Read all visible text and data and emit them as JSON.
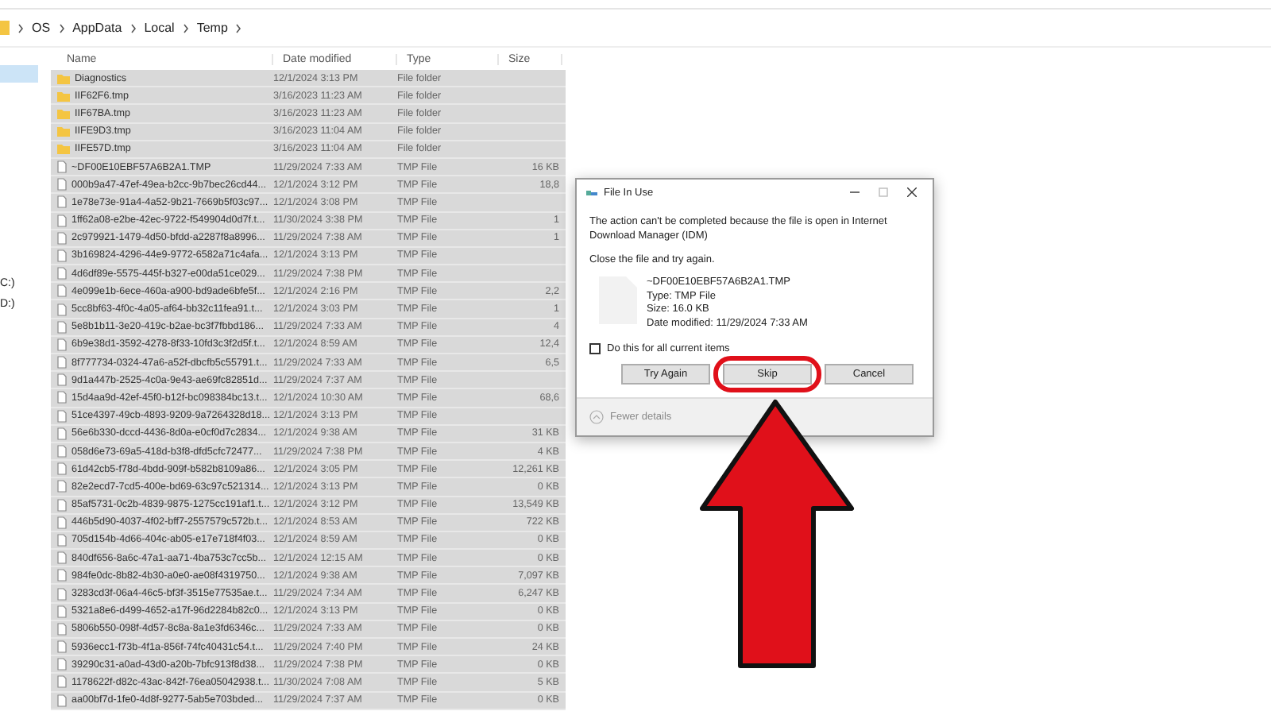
{
  "address_bar": {
    "crumbs": [
      "OS",
      "AppData",
      "Local",
      "Temp"
    ]
  },
  "nav_pane": {
    "items": [
      {
        "selected": true
      },
      {
        "label": "C:)",
        "selected": false
      },
      {
        "label": "D:)",
        "selected": false
      }
    ]
  },
  "table": {
    "columns": [
      "Name",
      "Date modified",
      "Type",
      "Size"
    ],
    "rows": [
      {
        "kind": "folder",
        "name": "Diagnostics",
        "date": "12/1/2024 3:13 PM",
        "type": "File folder"
      },
      {
        "kind": "folder",
        "name": "IIF62F6.tmp",
        "date": "3/16/2023 11:23 AM",
        "type": "File folder"
      },
      {
        "kind": "folder",
        "name": "IIF67BA.tmp",
        "date": "3/16/2023 11:23 AM",
        "type": "File folder"
      },
      {
        "kind": "folder",
        "name": "IIFE9D3.tmp",
        "date": "3/16/2023 11:04 AM",
        "type": "File folder"
      },
      {
        "kind": "folder",
        "name": "IIFE57D.tmp",
        "date": "3/16/2023 11:04 AM",
        "type": "File folder"
      },
      {
        "kind": "file",
        "name": "~DF00E10EBF57A6B2A1.TMP",
        "date": "11/29/2024 7:33 AM",
        "type": "TMP File",
        "size": "16 KB"
      },
      {
        "kind": "file",
        "name": "000b9a47-47ef-49ea-b2cc-9b7bec26cd44...",
        "date": "12/1/2024 3:12 PM",
        "type": "TMP File",
        "size": "18,8"
      },
      {
        "kind": "file",
        "name": "1e78e73e-91a4-4a52-9b21-7669b5f03c97...",
        "date": "12/1/2024 3:08 PM",
        "type": "TMP File"
      },
      {
        "kind": "file",
        "name": "1ff62a08-e2be-42ec-9722-f549904d0d7f.t...",
        "date": "11/30/2024 3:38 PM",
        "type": "TMP File",
        "size": "1"
      },
      {
        "kind": "file",
        "name": "2c979921-1479-4d50-bfdd-a2287f8a8996...",
        "date": "11/29/2024 7:38 AM",
        "type": "TMP File",
        "size": "1"
      },
      {
        "kind": "file",
        "name": "3b169824-4296-44e9-9772-6582a71c4afa...",
        "date": "12/1/2024 3:13 PM",
        "type": "TMP File"
      },
      {
        "kind": "file",
        "name": "4d6df89e-5575-445f-b327-e00da51ce029...",
        "date": "11/29/2024 7:38 PM",
        "type": "TMP File"
      },
      {
        "kind": "file",
        "name": "4e099e1b-6ece-460a-a900-bd9ade6bfe5f...",
        "date": "12/1/2024 2:16 PM",
        "type": "TMP File",
        "size": "2,2"
      },
      {
        "kind": "file",
        "name": "5cc8bf63-4f0c-4a05-af64-bb32c11fea91.t...",
        "date": "12/1/2024 3:03 PM",
        "type": "TMP File",
        "size": "1"
      },
      {
        "kind": "file",
        "name": "5e8b1b11-3e20-419c-b2ae-bc3f7fbbd186...",
        "date": "11/29/2024 7:33 AM",
        "type": "TMP File",
        "size": "4"
      },
      {
        "kind": "file",
        "name": "6b9e38d1-3592-4278-8f33-10fd3c3f2d5f.t...",
        "date": "12/1/2024 8:59 AM",
        "type": "TMP File",
        "size": "12,4"
      },
      {
        "kind": "file",
        "name": "8f777734-0324-47a6-a52f-dbcfb5c55791.t...",
        "date": "11/29/2024 7:33 AM",
        "type": "TMP File",
        "size": "6,5"
      },
      {
        "kind": "file",
        "name": "9d1a447b-2525-4c0a-9e43-ae69fc82851d...",
        "date": "11/29/2024 7:37 AM",
        "type": "TMP File"
      },
      {
        "kind": "file",
        "name": "15d4aa9d-42ef-45f0-b12f-bc098384bc13.t...",
        "date": "12/1/2024 10:30 AM",
        "type": "TMP File",
        "size": "68,6"
      },
      {
        "kind": "file",
        "name": "51ce4397-49cb-4893-9209-9a7264328d18...",
        "date": "12/1/2024 3:13 PM",
        "type": "TMP File"
      },
      {
        "kind": "file",
        "name": "56e6b330-dccd-4436-8d0a-e0cf0d7c2834...",
        "date": "12/1/2024 9:38 AM",
        "type": "TMP File",
        "size": "31 KB"
      },
      {
        "kind": "file",
        "name": "058d6e73-69a5-418d-b3f8-dfd5cfc72477...",
        "date": "11/29/2024 7:38 PM",
        "type": "TMP File",
        "size": "4 KB"
      },
      {
        "kind": "file",
        "name": "61d42cb5-f78d-4bdd-909f-b582b8109a86...",
        "date": "12/1/2024 3:05 PM",
        "type": "TMP File",
        "size": "12,261 KB"
      },
      {
        "kind": "file",
        "name": "82e2ecd7-7cd5-400e-bd69-63c97c521314...",
        "date": "12/1/2024 3:13 PM",
        "type": "TMP File",
        "size": "0 KB"
      },
      {
        "kind": "file",
        "name": "85af5731-0c2b-4839-9875-1275cc191af1.t...",
        "date": "12/1/2024 3:12 PM",
        "type": "TMP File",
        "size": "13,549 KB"
      },
      {
        "kind": "file",
        "name": "446b5d90-4037-4f02-bff7-2557579c572b.t...",
        "date": "12/1/2024 8:53 AM",
        "type": "TMP File",
        "size": "722 KB"
      },
      {
        "kind": "file",
        "name": "705d154b-4d66-404c-ab05-e17e718f4f03...",
        "date": "12/1/2024 8:59 AM",
        "type": "TMP File",
        "size": "0 KB"
      },
      {
        "kind": "file",
        "name": "840df656-8a6c-47a1-aa71-4ba753c7cc5b...",
        "date": "12/1/2024 12:15 AM",
        "type": "TMP File",
        "size": "0 KB"
      },
      {
        "kind": "file",
        "name": "984fe0dc-8b82-4b30-a0e0-ae08f4319750...",
        "date": "12/1/2024 9:38 AM",
        "type": "TMP File",
        "size": "7,097 KB"
      },
      {
        "kind": "file",
        "name": "3283cd3f-06a4-46c5-bf3f-3515e77535ae.t...",
        "date": "11/29/2024 7:34 AM",
        "type": "TMP File",
        "size": "6,247 KB"
      },
      {
        "kind": "file",
        "name": "5321a8e6-d499-4652-a17f-96d2284b82c0...",
        "date": "12/1/2024 3:13 PM",
        "type": "TMP File",
        "size": "0 KB"
      },
      {
        "kind": "file",
        "name": "5806b550-098f-4d57-8c8a-8a1e3fd6346c...",
        "date": "11/29/2024 7:33 AM",
        "type": "TMP File",
        "size": "0 KB"
      },
      {
        "kind": "file",
        "name": "5936ecc1-f73b-4f1a-856f-74fc40431c54.t...",
        "date": "11/29/2024 7:40 PM",
        "type": "TMP File",
        "size": "24 KB"
      },
      {
        "kind": "file",
        "name": "39290c31-a0ad-43d0-a20b-7bfc913f8d38...",
        "date": "11/29/2024 7:38 PM",
        "type": "TMP File",
        "size": "0 KB"
      },
      {
        "kind": "file",
        "name": "1178622f-d82c-43ac-842f-76ea05042938.t...",
        "date": "11/30/2024 7:08 AM",
        "type": "TMP File",
        "size": "5 KB"
      },
      {
        "kind": "file",
        "name": "aa00bf7d-1fe0-4d8f-9277-5ab5e703bded...",
        "date": "11/29/2024 7:37 AM",
        "type": "TMP File",
        "size": "0 KB"
      }
    ]
  },
  "dialog": {
    "title": "File In Use",
    "message": "The action can't be completed because the file is open in Internet Download Manager (IDM)",
    "instruction": "Close the file and try again.",
    "file": {
      "name": "~DF00E10EBF57A6B2A1.TMP",
      "type": "Type: TMP File",
      "size": "Size: 16.0 KB",
      "date": "Date modified: 11/29/2024 7:33 AM"
    },
    "checkbox": {
      "label": "Do this for all current items",
      "checked": false
    },
    "buttons": [
      {
        "label": "Try Again",
        "highlighted": false
      },
      {
        "label": "Skip",
        "highlighted": true
      },
      {
        "label": "Cancel",
        "highlighted": false
      }
    ],
    "footer": "Fewer details"
  }
}
